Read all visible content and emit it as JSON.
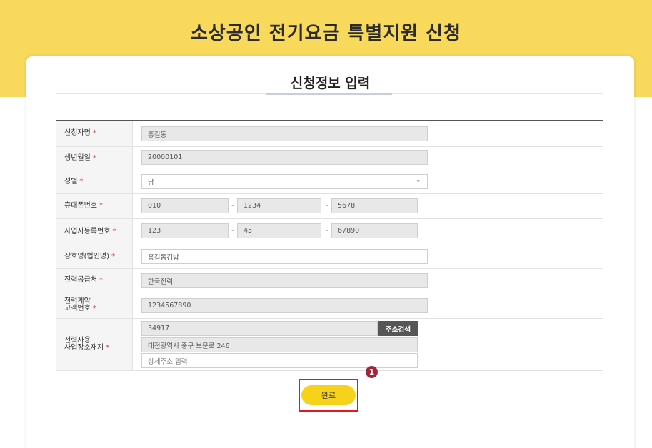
{
  "banner": {
    "title": "소상공인 전기요금 특별지원 신청"
  },
  "section": {
    "title": "신청정보 입력"
  },
  "form": {
    "required_mark": "*",
    "name": {
      "label": "신청자명",
      "value": "홍길동"
    },
    "birth": {
      "label": "생년월일",
      "value": "20000101"
    },
    "gender": {
      "label": "성별",
      "value": "남"
    },
    "phone": {
      "label": "휴대폰번호",
      "part1": "010",
      "part2": "1234",
      "part3": "5678",
      "separator": "-"
    },
    "business_number": {
      "label": "사업자등록번호",
      "part1": "123",
      "part2": "45",
      "part3": "67890",
      "separator": "-"
    },
    "company_name": {
      "label": "상호명(법인명)",
      "value": "홍길동김밥"
    },
    "supplier": {
      "label": "전력공급처",
      "value": "한국전력"
    },
    "contract": {
      "label_line1": "전력계약",
      "label_line2": "고객번호",
      "value": "1234567890"
    },
    "address": {
      "label_line1": "전력사용",
      "label_line2": "사업장소재지",
      "zipcode": "34917",
      "search_button": "주소검색",
      "road_address": "대전광역시 중구 보문로 246",
      "detail_placeholder": "상세주소 입력"
    }
  },
  "actions": {
    "step_badge": "1",
    "done_button": "완료"
  },
  "colors": {
    "banner": "#f8d95c",
    "button": "#f7d21a",
    "highlight": "#e0191e",
    "required": "#e03131"
  }
}
